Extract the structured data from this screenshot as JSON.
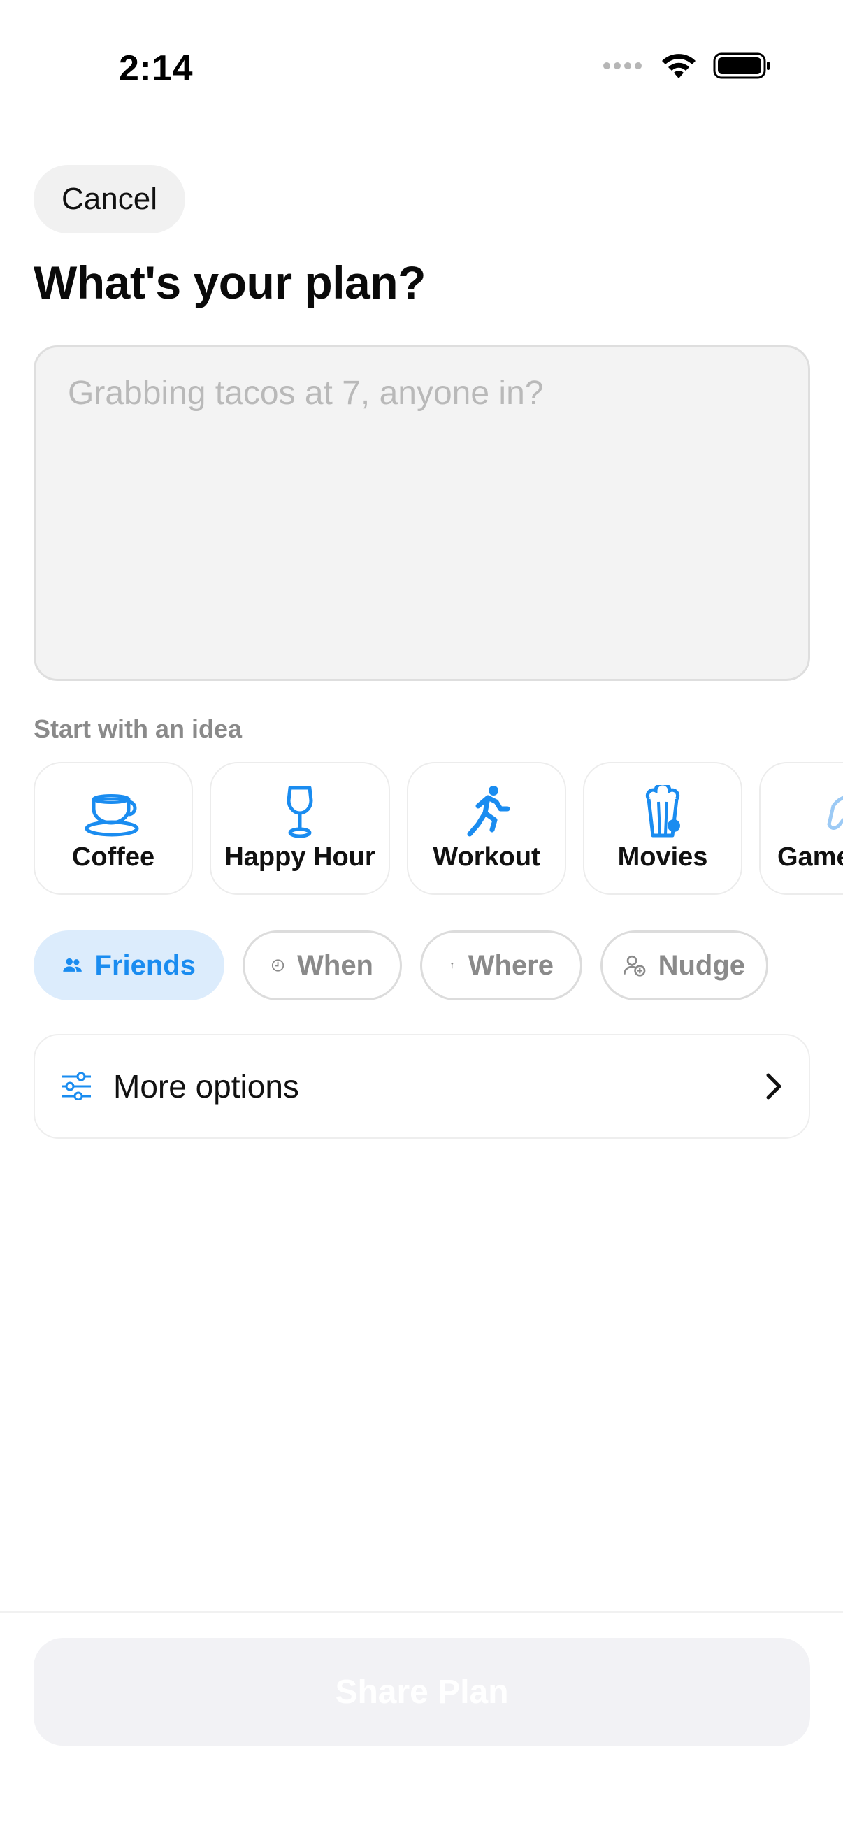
{
  "status_bar": {
    "time": "2:14"
  },
  "header": {
    "cancel_label": "Cancel",
    "title": "What's your plan?"
  },
  "plan_input": {
    "placeholder": "Grabbing tacos at 7, anyone in?",
    "value": ""
  },
  "ideas": {
    "label": "Start with an idea",
    "items": [
      {
        "label": "Coffee",
        "icon": "coffee-cup-icon"
      },
      {
        "label": "Happy Hour",
        "icon": "wine-glass-icon"
      },
      {
        "label": "Workout",
        "icon": "running-person-icon"
      },
      {
        "label": "Movies",
        "icon": "popcorn-icon"
      },
      {
        "label": "Game",
        "icon": "game-controller-icon"
      }
    ]
  },
  "chips": [
    {
      "label": "Friends",
      "icon": "people-icon",
      "active": true
    },
    {
      "label": "When",
      "icon": "clock-icon",
      "active": false
    },
    {
      "label": "Where",
      "icon": "pin-icon",
      "active": false
    },
    {
      "label": "Nudge",
      "icon": "person-add-icon",
      "active": false
    }
  ],
  "more_options": {
    "label": "More options",
    "icon": "sliders-icon"
  },
  "footer": {
    "share_label": "Share Plan"
  },
  "colors": {
    "accent": "#1a8cf0",
    "chip_active_bg": "#dcecfc",
    "share_disabled_bg": "#f2f2f5"
  }
}
